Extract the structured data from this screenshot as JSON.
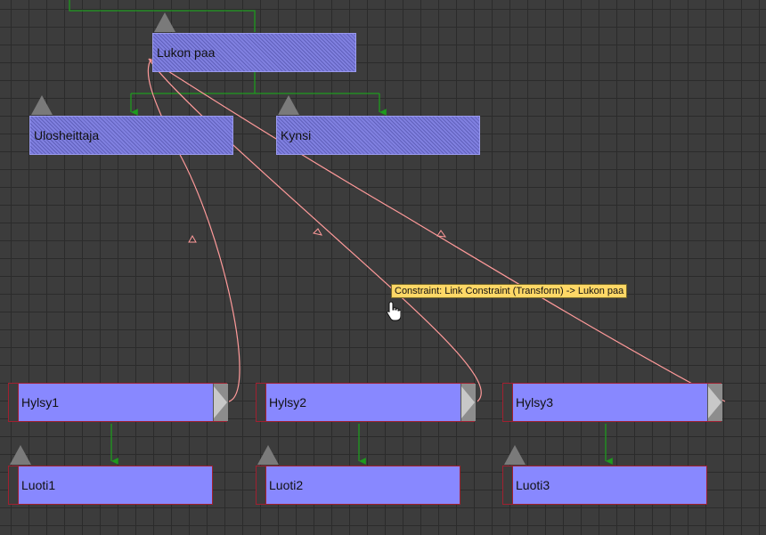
{
  "nodes": {
    "lukon_paa": "Lukon paa",
    "ulosheittaja": "Ulosheittaja",
    "kynsi": "Kynsi",
    "hylsy1": "Hylsy1",
    "hylsy2": "Hylsy2",
    "hylsy3": "Hylsy3",
    "luoti1": "Luoti1",
    "luoti2": "Luoti2",
    "luoti3": "Luoti3"
  },
  "tooltip": "Constraint: Link Constraint (Transform) -> Lukon paa",
  "colors": {
    "background": "#3c3c3c",
    "grid": "#2b2b2b",
    "node_fill": "#8888ff",
    "node_border": "#a02030",
    "hierarchy_wire": "#1e9a1e",
    "constraint_wire": "#ff9a9a",
    "tooltip_bg": "#ffd866"
  },
  "icons": {
    "node_marker": "triangle-up-icon",
    "rollout": "triangle-right-icon",
    "cursor": "hand-pointer-icon"
  }
}
